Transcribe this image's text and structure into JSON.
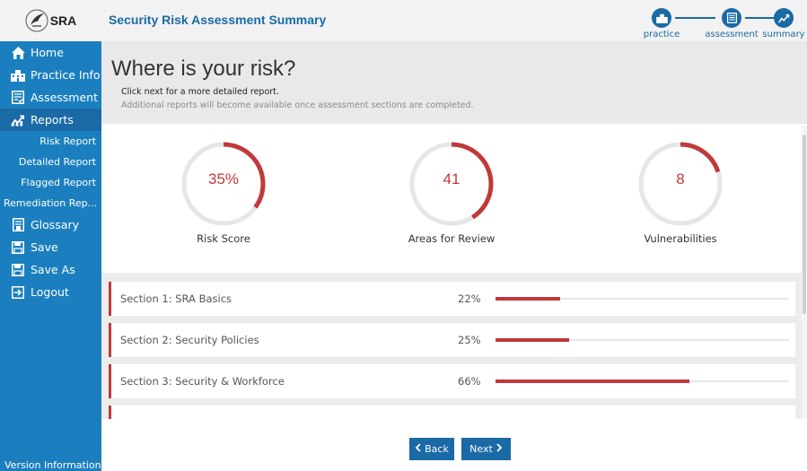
{
  "app": {
    "logo_text": "SRA",
    "page_title": "Security Risk Assessment Summary"
  },
  "sidebar": {
    "items": [
      {
        "label": "Home",
        "icon": "home-icon"
      },
      {
        "label": "Practice Info",
        "icon": "building-icon"
      },
      {
        "label": "Assessment",
        "icon": "checklist-icon"
      },
      {
        "label": "Reports",
        "icon": "chart-icon"
      }
    ],
    "report_items": [
      {
        "label": "Risk Report"
      },
      {
        "label": "Detailed Report"
      },
      {
        "label": "Flagged Report"
      },
      {
        "label": "Remediation Rep..."
      }
    ],
    "bottom_items": [
      {
        "label": "Glossary",
        "icon": "book-icon"
      },
      {
        "label": "Save",
        "icon": "save-icon"
      },
      {
        "label": "Save As",
        "icon": "save-as-icon"
      },
      {
        "label": "Logout",
        "icon": "logout-icon"
      }
    ],
    "version_label": "Version Information"
  },
  "steps": [
    {
      "label": "practice",
      "icon": "building-icon"
    },
    {
      "label": "assessment",
      "icon": "checklist-icon"
    },
    {
      "label": "summary",
      "icon": "chart-icon"
    }
  ],
  "banner": {
    "heading": "Where is your risk?",
    "line1": "Click next for a more detailed report.",
    "line2": "Additional reports will become available once assessment sections are completed."
  },
  "gauges": [
    {
      "value": "35%",
      "label": "Risk Score",
      "fraction": 0.35
    },
    {
      "value": "41",
      "label": "Areas for Review",
      "fraction": 0.41
    },
    {
      "value": "8",
      "label": "Vulnerabilities",
      "fraction": 0.2
    }
  ],
  "sections": [
    {
      "name": "Section 1: SRA Basics",
      "percent": "22%",
      "fraction": 0.22
    },
    {
      "name": "Section 2: Security Policies",
      "percent": "25%",
      "fraction": 0.25
    },
    {
      "name": "Section 3: Security & Workforce",
      "percent": "66%",
      "fraction": 0.66
    }
  ],
  "buttons": {
    "back": "Back",
    "next": "Next"
  },
  "colors": {
    "primary": "#1a6aa5",
    "sidebar": "#1b7fbf",
    "accent": "#c0393b"
  }
}
